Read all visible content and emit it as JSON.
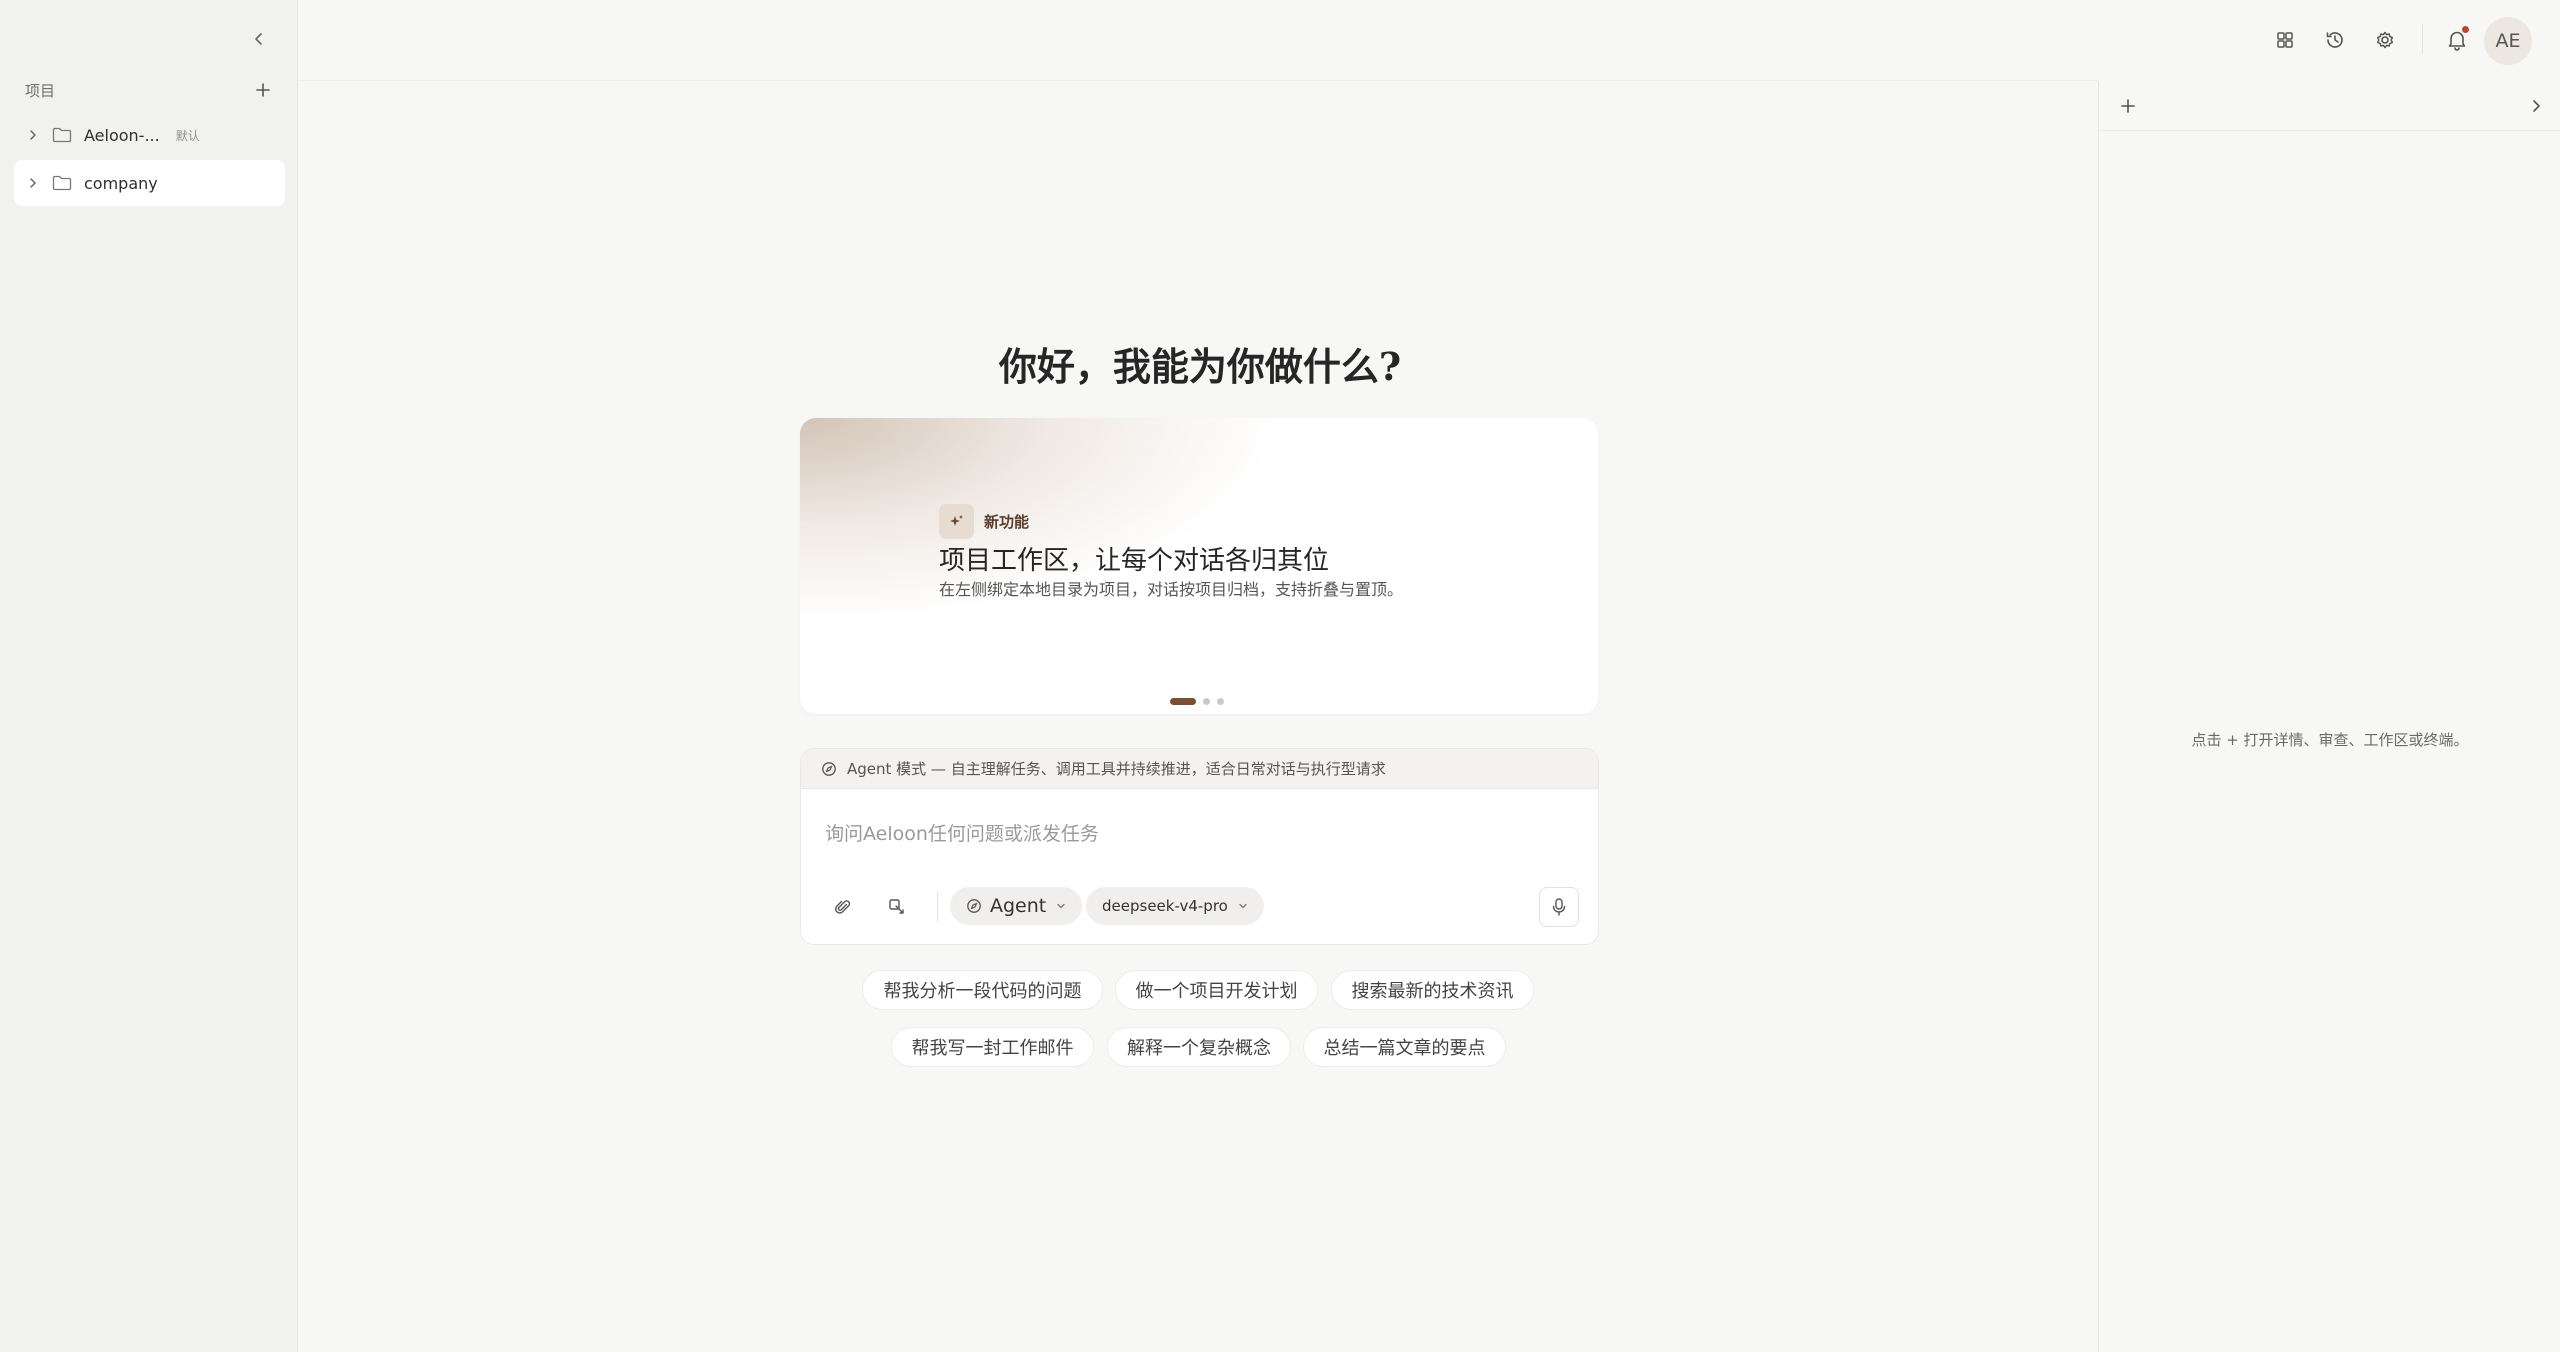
{
  "sidebar": {
    "header_label": "项目",
    "projects": [
      {
        "name": "Aeloon-...",
        "badge": "默认"
      },
      {
        "name": "company",
        "badge": ""
      }
    ]
  },
  "topbar": {
    "icons": [
      "layout-grid-icon",
      "history-icon",
      "settings-icon",
      "bell-icon"
    ],
    "avatar_initials": "AE"
  },
  "main": {
    "greeting": "你好，我能为你做什么?",
    "banner": {
      "badge": "新功能",
      "title": "项目工作区，让每个对话各归其位",
      "description": "在左侧绑定本地目录为项目，对话按项目归档，支持折叠与置顶。",
      "slides": 3,
      "active_slide": 1
    },
    "composer": {
      "mode_hint": "Agent 模式 — 自主理解任务、调用工具并持续推进，适合日常对话与执行型请求",
      "placeholder": "询问Aeloon任何问题或派发任务",
      "value": "",
      "mode_label": "Agent",
      "model_label": "deepseek-v4-pro"
    },
    "suggestions": [
      "帮我分析一段代码的问题",
      "做一个项目开发计划",
      "搜索最新的技术资讯",
      "帮我写一封工作邮件",
      "解释一个复杂概念",
      "总结一篇文章的要点"
    ]
  },
  "right_panel": {
    "hint": "点击 + 打开详情、审查、工作区或终端。"
  },
  "colors": {
    "accent_brown": "#7a4f34",
    "notification_dot": "#b44a2c",
    "sidebar_bg": "#f1f1f0",
    "page_bg": "#f7f7f6"
  }
}
